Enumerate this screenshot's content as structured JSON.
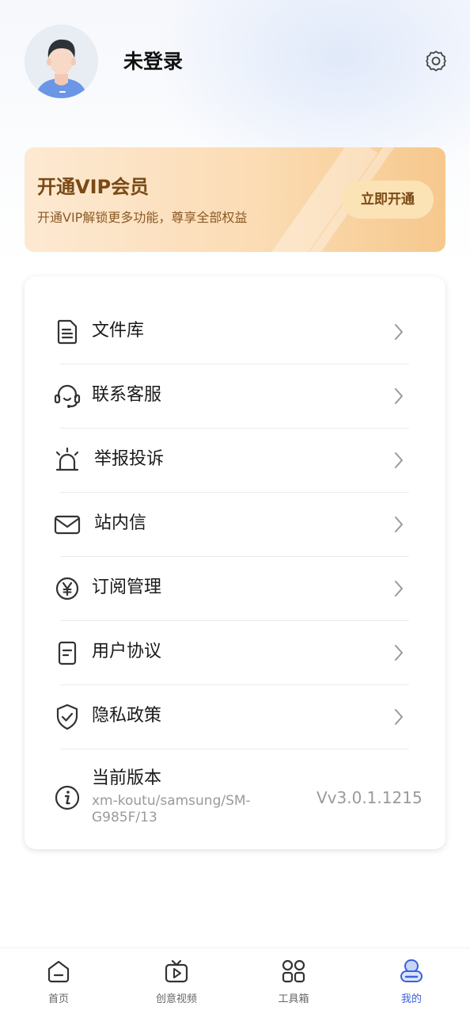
{
  "profile": {
    "username": "未登录"
  },
  "vip": {
    "title": "开通VIP会员",
    "subtitle": "开通VIP解锁更多功能，尊享全部权益",
    "button": "立即开通"
  },
  "menu": {
    "items": [
      {
        "label": "文件库",
        "icon": "file-icon"
      },
      {
        "label": "联系客服",
        "icon": "headset-icon"
      },
      {
        "label": "举报投诉",
        "icon": "alarm-icon"
      },
      {
        "label": "站内信",
        "icon": "mail-icon"
      },
      {
        "label": "订阅管理",
        "icon": "yen-icon"
      },
      {
        "label": "用户协议",
        "icon": "document-icon"
      },
      {
        "label": "隐私政策",
        "icon": "shield-check-icon"
      }
    ],
    "version": {
      "title": "当前版本",
      "subtitle": "xm-koutu/samsung/SM-G985F/13",
      "value": "Vv3.0.1.1215",
      "icon": "info-icon"
    }
  },
  "tabbar": {
    "tabs": [
      {
        "label": "首页",
        "icon": "home-icon",
        "active": false
      },
      {
        "label": "创意视频",
        "icon": "video-icon",
        "active": false
      },
      {
        "label": "工具箱",
        "icon": "grid-icon",
        "active": false
      },
      {
        "label": "我的",
        "icon": "profile-icon",
        "active": true
      }
    ]
  },
  "colors": {
    "accent": "#3a62d8",
    "vip_text": "#7a4a15",
    "vip_gradient_start": "#fde9d2",
    "vip_gradient_end": "#f6c88d"
  }
}
